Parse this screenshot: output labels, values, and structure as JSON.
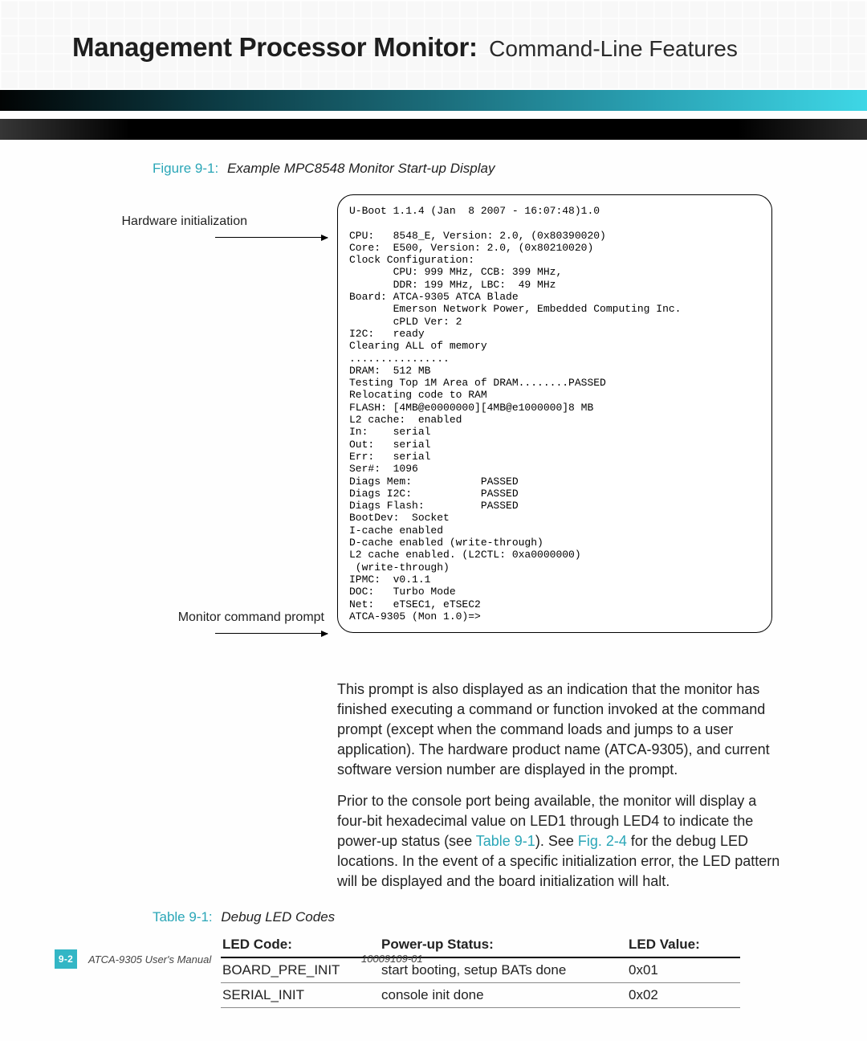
{
  "header": {
    "title_bold": "Management Processor Monitor:",
    "title_light": "Command-Line Features"
  },
  "figure": {
    "number": "Figure 9-1:",
    "title": "Example MPC8548 Monitor Start-up Display",
    "callout1": "Hardware initialization",
    "callout2": "Monitor command prompt",
    "terminal": "U-Boot 1.1.4 (Jan  8 2007 - 16:07:48)1.0\n\nCPU:   8548_E, Version: 2.0, (0x80390020)\nCore:  E500, Version: 2.0, (0x80210020)\nClock Configuration:\n       CPU: 999 MHz, CCB: 399 MHz,\n       DDR: 199 MHz, LBC:  49 MHz\nBoard: ATCA-9305 ATCA Blade\n       Emerson Network Power, Embedded Computing Inc.\n       cPLD Ver: 2\nI2C:   ready\nClearing ALL of memory\n................\nDRAM:  512 MB\nTesting Top 1M Area of DRAM........PASSED\nRelocating code to RAM\nFLASH: [4MB@e0000000][4MB@e1000000]8 MB\nL2 cache:  enabled\nIn:    serial\nOut:   serial\nErr:   serial\nSer#:  1096\nDiags Mem:           PASSED\nDiags I2C:           PASSED\nDiags Flash:         PASSED\nBootDev:  Socket\nI-cache enabled\nD-cache enabled (write-through)\nL2 cache enabled. (L2CTL: 0xa0000000)\n (write-through)\nIPMC:  v0.1.1\nDOC:   Turbo Mode\nNet:   eTSEC1, eTSEC2\nATCA-9305 (Mon 1.0)=>"
  },
  "paragraphs": {
    "p1": "This prompt is also displayed as an indication that the monitor has finished executing a command or function invoked at the command prompt (except when the command loads and jumps to a user application). The hardware product name (ATCA-9305), and current software version number are displayed in the prompt.",
    "p2_a": "Prior to the console port being available, the monitor will display a four-bit hexadecimal value on LED1 through LED4 to indicate the power-up status (see ",
    "p2_link1": "Table 9-1",
    "p2_b": "). See ",
    "p2_link2": "Fig. 2-4",
    "p2_c": " for the debug LED locations. In the event of a specific initialization error, the LED pattern will be displayed and the board initialization will halt."
  },
  "table": {
    "number": "Table 9-1:",
    "title": "Debug LED Codes",
    "headers": {
      "c1": "LED Code:",
      "c2": "Power-up Status:",
      "c3": "LED Value:"
    },
    "rows": [
      {
        "c1": "BOARD_PRE_INIT",
        "c2": "start booting, setup BATs done",
        "c3": "0x01"
      },
      {
        "c1": "SERIAL_INIT",
        "c2": "console init done",
        "c3": "0x02"
      }
    ]
  },
  "footer": {
    "page_num": "9-2",
    "manual": "ATCA-9305 User's Manual",
    "docnum": "10009109-01"
  }
}
